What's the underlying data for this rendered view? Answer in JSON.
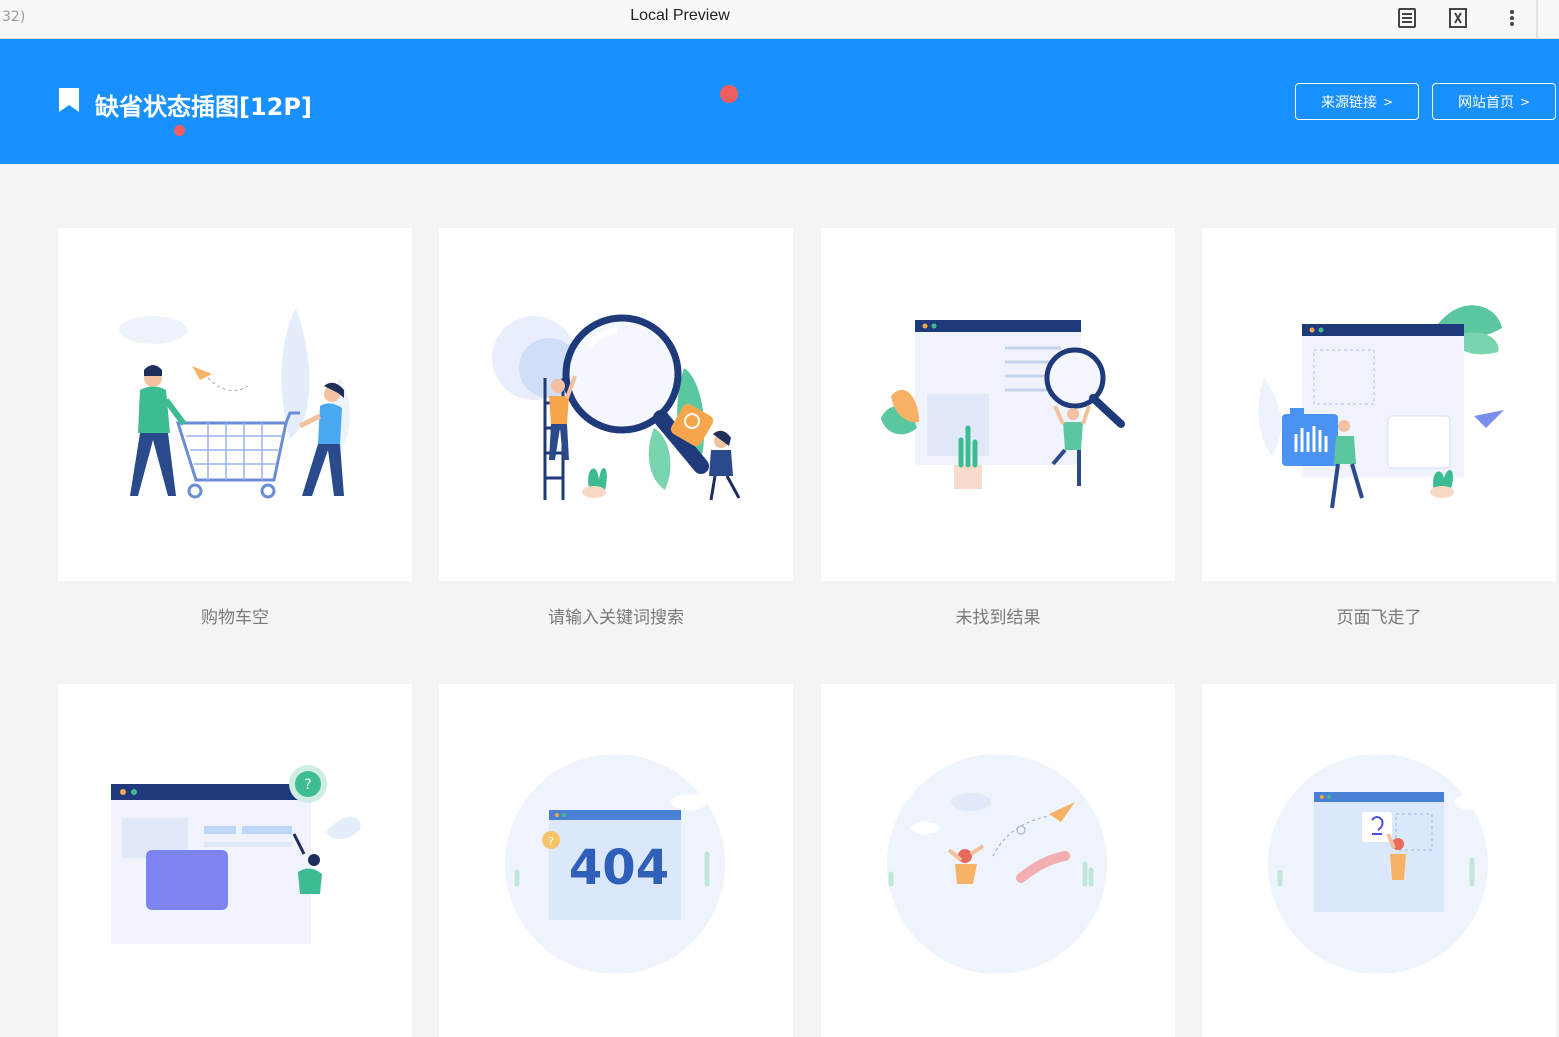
{
  "window": {
    "left_fragment": "32)",
    "title": "Local Preview"
  },
  "toolbar_icons": [
    "reader-icon",
    "formula-icon",
    "more-vert-icon"
  ],
  "header": {
    "title": "缺省状态插图[12P]",
    "source_link_label": "来源链接",
    "home_link_label": "网站首页",
    "bg_color": "#1890ff"
  },
  "cards": [
    {
      "caption": "购物车空",
      "illustration": "empty-cart-illustration"
    },
    {
      "caption": "请输入关键词搜索",
      "illustration": "search-keyword-illustration"
    },
    {
      "caption": "未找到结果",
      "illustration": "no-result-illustration"
    },
    {
      "caption": "页面飞走了",
      "illustration": "page-flew-away-illustration"
    },
    {
      "caption": "",
      "illustration": "help-page-illustration"
    },
    {
      "caption": "",
      "illustration": "404-illustration"
    },
    {
      "caption": "",
      "illustration": "paper-plane-illustration"
    },
    {
      "caption": "",
      "illustration": "idea-page-illustration"
    }
  ]
}
